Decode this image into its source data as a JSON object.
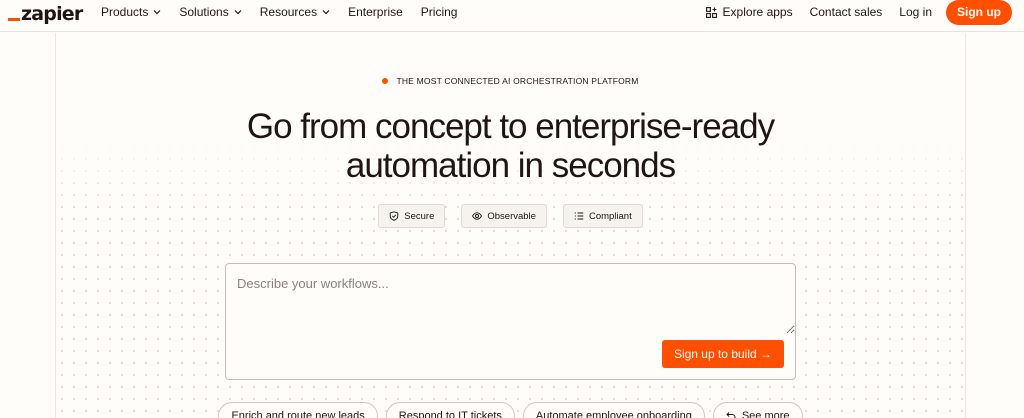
{
  "brand": {
    "logo_text": "zapier",
    "accent_color": "#ff4f00"
  },
  "nav": {
    "left_items": [
      {
        "label": "Products",
        "has_dropdown": true
      },
      {
        "label": "Solutions",
        "has_dropdown": true
      },
      {
        "label": "Resources",
        "has_dropdown": true
      },
      {
        "label": "Enterprise",
        "has_dropdown": false
      },
      {
        "label": "Pricing",
        "has_dropdown": false
      }
    ],
    "explore_apps": {
      "label": "Explore apps",
      "icon": "apps-grid-icon"
    },
    "contact_sales": "Contact sales",
    "log_in": "Log in",
    "sign_up": "Sign up"
  },
  "hero": {
    "eyebrow": "THE MOST CONNECTED AI ORCHESTRATION PLATFORM",
    "headline_line1": "Go from concept to enterprise-ready",
    "headline_line2": "automation in seconds",
    "badges": [
      {
        "label": "Secure",
        "icon": "shield-icon"
      },
      {
        "label": "Observable",
        "icon": "eye-icon"
      },
      {
        "label": "Compliant",
        "icon": "checklist-icon"
      }
    ],
    "prompt": {
      "placeholder": "Describe your workflows...",
      "value": "",
      "button_label": "Sign up to build →"
    },
    "suggestions": [
      {
        "label": "Enrich and route new leads"
      },
      {
        "label": "Respond to IT tickets"
      },
      {
        "label": "Automate employee onboarding"
      },
      {
        "label": "See more",
        "icon": "undo-icon"
      }
    ]
  }
}
